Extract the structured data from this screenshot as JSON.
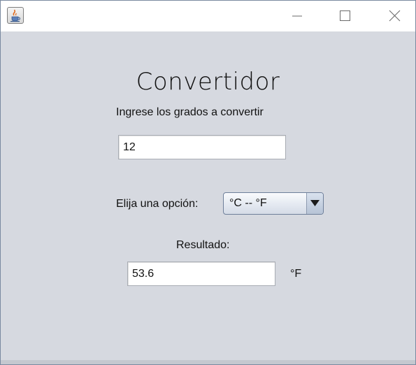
{
  "window": {
    "app_icon": "java-coffee-cup-icon",
    "controls": [
      "minimize-icon",
      "maximize-icon",
      "close-icon"
    ]
  },
  "form": {
    "title": "Convertidor",
    "prompt": "Ingrese los grados a convertir",
    "degrees_value": "12",
    "option_label": "Elija una opción:",
    "option_selected": "°C -- °F",
    "result_label": "Resultado:",
    "result_value": "53.6",
    "result_unit": "°F"
  },
  "colors": {
    "background": "#d6d9e0",
    "titlebar": "#ffffff",
    "combo_border": "#6e7f9a"
  }
}
